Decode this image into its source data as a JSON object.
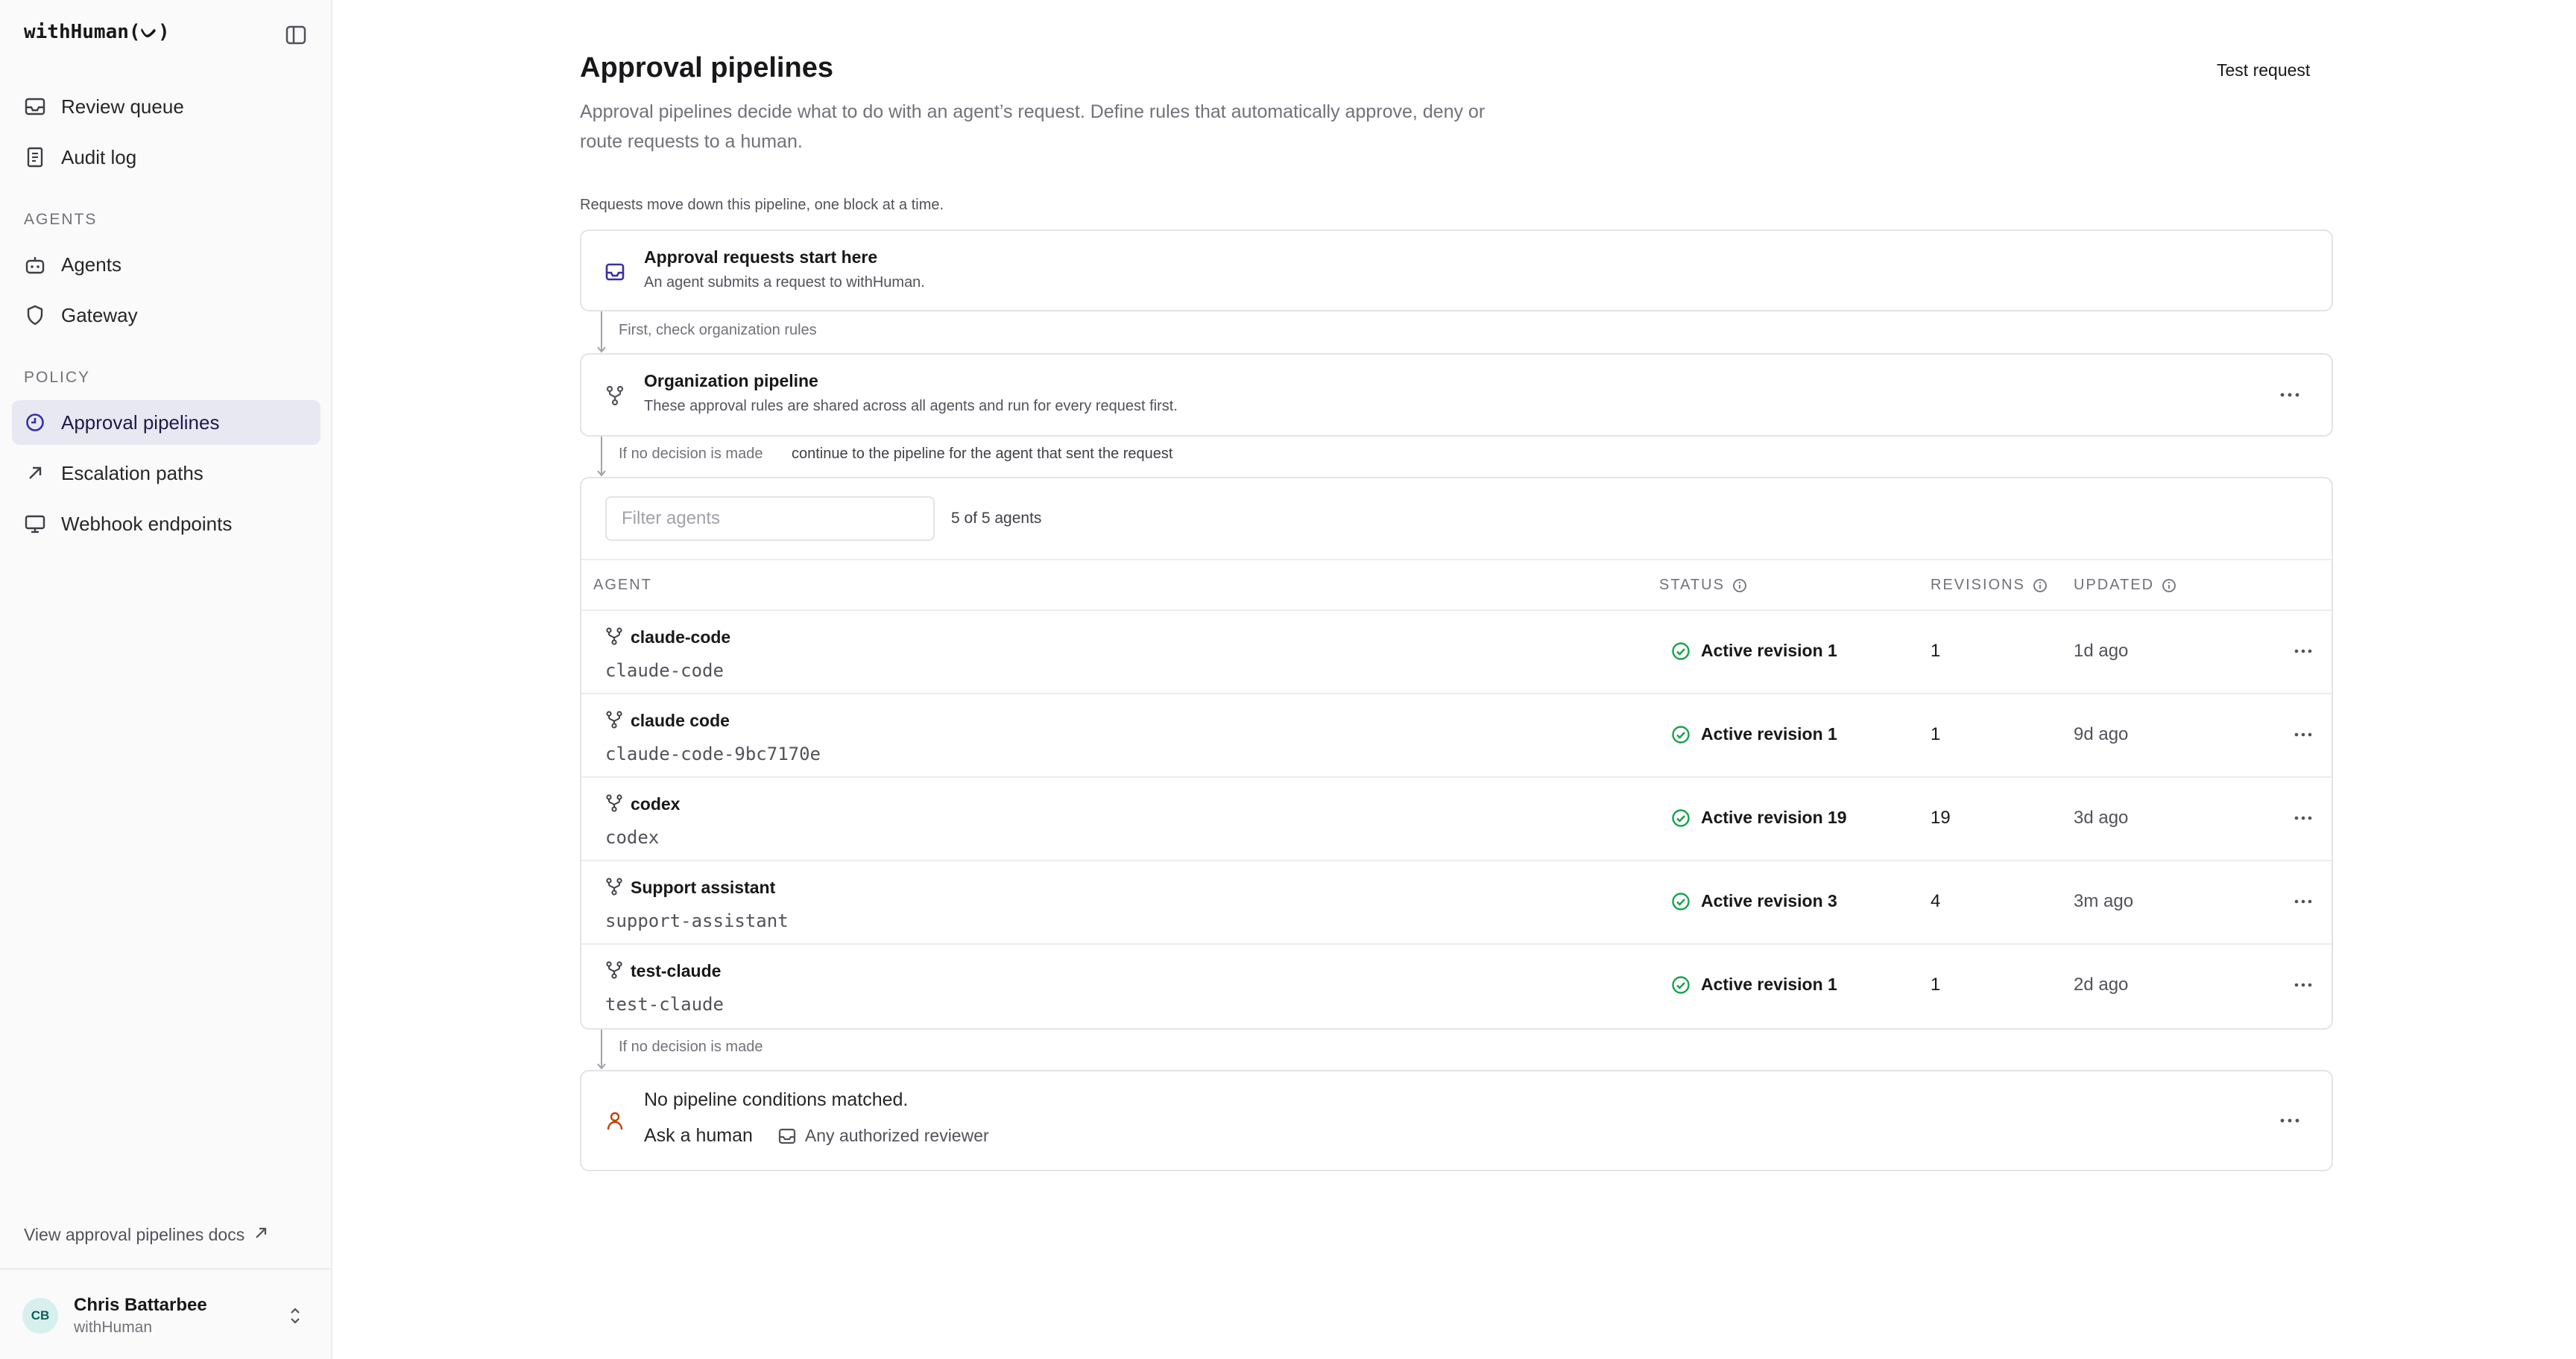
{
  "app": {
    "brand": "withHuman(ᨆ)"
  },
  "sidebar": {
    "top_items": [
      {
        "label": "Review queue",
        "icon": "inbox-icon"
      },
      {
        "label": "Audit log",
        "icon": "document-icon"
      }
    ],
    "agents_section": "AGENTS",
    "agents_items": [
      {
        "label": "Agents",
        "icon": "robot-icon"
      },
      {
        "label": "Gateway",
        "icon": "shield-icon"
      }
    ],
    "policy_section": "POLICY",
    "policy_items": [
      {
        "label": "Approval pipelines",
        "icon": "clock-icon",
        "active": true
      },
      {
        "label": "Escalation paths",
        "icon": "arrow-up-right-icon"
      },
      {
        "label": "Webhook endpoints",
        "icon": "monitor-icon"
      }
    ],
    "docs_link": "View approval pipelines docs",
    "user": {
      "initials": "CB",
      "name": "Chris Battarbee",
      "org": "withHuman"
    }
  },
  "main": {
    "title": "Approval pipelines",
    "test_request": "Test request",
    "description": "Approval pipelines decide what to do with an agent’s request. Define rules that automatically approve, deny or route requests to a human.",
    "flow_hint": "Requests move down this pipeline, one block at a time.",
    "start_card": {
      "title": "Approval requests start here",
      "subtitle": "An agent submits a request to withHuman."
    },
    "connector1": "First, check organization rules",
    "org_card": {
      "title": "Organization pipeline",
      "subtitle": "These approval rules are shared across all agents and run for every request first."
    },
    "connector2": {
      "condition": "If no decision is made",
      "action": "continue to the pipeline for the agent that sent the request"
    },
    "agents_table": {
      "filter_placeholder": "Filter agents",
      "count": "5 of 5 agents",
      "columns": {
        "agent": "AGENT",
        "status": "STATUS",
        "revisions": "REVISIONS",
        "updated": "UPDATED"
      },
      "rows": [
        {
          "name": "claude-code",
          "slug": "claude-code",
          "status": "Active revision 1",
          "revisions": "1",
          "updated": "1d ago"
        },
        {
          "name": "claude code",
          "slug": "claude-code-9bc7170e",
          "status": "Active revision 1",
          "revisions": "1",
          "updated": "9d ago"
        },
        {
          "name": "codex",
          "slug": "codex",
          "status": "Active revision 19",
          "revisions": "19",
          "updated": "3d ago"
        },
        {
          "name": "Support assistant",
          "slug": "support-assistant",
          "status": "Active revision 3",
          "revisions": "4",
          "updated": "3m ago"
        },
        {
          "name": "test-claude",
          "slug": "test-claude",
          "status": "Active revision 1",
          "revisions": "1",
          "updated": "2d ago"
        }
      ]
    },
    "connector3": "If no decision is made",
    "fallback_card": {
      "title": "No pipeline conditions matched.",
      "action": "Ask a human",
      "reviewer": "Any authorized reviewer"
    }
  },
  "colors": {
    "accent": "#3730a3",
    "status_green": "#16a34a",
    "human_orange": "#c2410c"
  }
}
